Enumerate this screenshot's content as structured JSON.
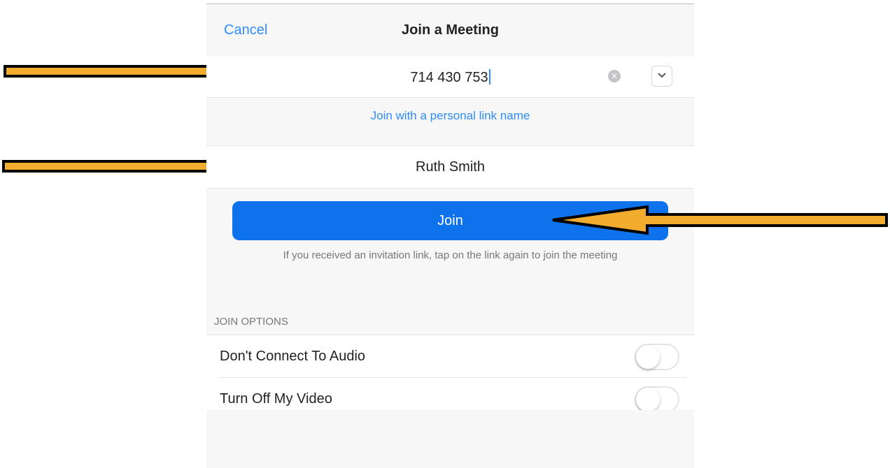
{
  "header": {
    "cancel_label": "Cancel",
    "title": "Join a Meeting"
  },
  "meeting_id": {
    "value": "714 430 753",
    "clear_icon": "clear-circle-icon",
    "history_icon": "chevron-down-icon"
  },
  "personal_link": {
    "label": "Join with a personal link name"
  },
  "name_field": {
    "value": "Ruth Smith"
  },
  "join": {
    "label": "Join",
    "hint": "If you received an invitation link, tap on the link again to join the meeting"
  },
  "options": {
    "header": "JOIN OPTIONS",
    "items": [
      {
        "label": "Don't Connect To Audio",
        "on": false
      },
      {
        "label": "Turn Off My Video",
        "on": false
      }
    ]
  },
  "colors": {
    "accent": "#2d8cff",
    "join_button": "#0e72ed",
    "annotation_arrow": "#f2ac2e"
  }
}
